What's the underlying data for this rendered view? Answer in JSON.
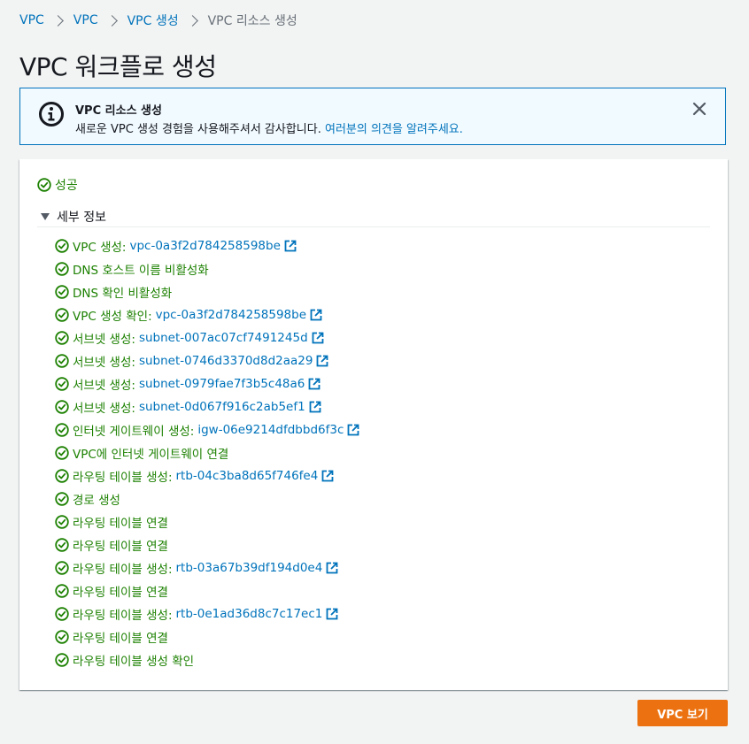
{
  "breadcrumb": {
    "items": [
      "VPC",
      "VPC",
      "VPC 생성"
    ],
    "current": "VPC 리소스 생성"
  },
  "page_title": "VPC 워크플로 생성",
  "flash": {
    "title": "VPC 리소스 생성",
    "message": "새로운 VPC 생성 경험을 사용해주셔서 감사합니다. ",
    "link": "여러분의 의견을 알려주세요."
  },
  "status": {
    "success_label": "성공",
    "details_label": "세부 정보"
  },
  "steps": [
    {
      "label": "VPC 생성:",
      "link": "vpc-0a3f2d784258598be"
    },
    {
      "label": "DNS 호스트 이름 비활성화",
      "link": null
    },
    {
      "label": "DNS 확인 비활성화",
      "link": null
    },
    {
      "label": "VPC 생성 확인:",
      "link": "vpc-0a3f2d784258598be"
    },
    {
      "label": "서브넷 생성:",
      "link": "subnet-007ac07cf7491245d"
    },
    {
      "label": "서브넷 생성:",
      "link": "subnet-0746d3370d8d2aa29"
    },
    {
      "label": "서브넷 생성:",
      "link": "subnet-0979fae7f3b5c48a6"
    },
    {
      "label": "서브넷 생성:",
      "link": "subnet-0d067f916c2ab5ef1"
    },
    {
      "label": "인터넷 게이트웨이 생성:",
      "link": "igw-06e9214dfdbbd6f3c"
    },
    {
      "label": "VPC에 인터넷 게이트웨이 연결",
      "link": null
    },
    {
      "label": "라우팅 테이블 생성:",
      "link": "rtb-04c3ba8d65f746fe4"
    },
    {
      "label": "경로 생성",
      "link": null
    },
    {
      "label": "라우팅 테이블 연결",
      "link": null
    },
    {
      "label": "라우팅 테이블 연결",
      "link": null
    },
    {
      "label": "라우팅 테이블 생성:",
      "link": "rtb-03a67b39df194d0e4"
    },
    {
      "label": "라우팅 테이블 연결",
      "link": null
    },
    {
      "label": "라우팅 테이블 생성:",
      "link": "rtb-0e1ad36d8c7c17ec1"
    },
    {
      "label": "라우팅 테이블 연결",
      "link": null
    },
    {
      "label": "라우팅 테이블 생성 확인",
      "link": null
    }
  ],
  "footer": {
    "view_vpc_label": "VPC 보기"
  },
  "colors": {
    "link": "#0073bb",
    "success": "#1d8102",
    "primary": "#ec7211",
    "info_border": "#0073bb",
    "info_bg": "#f1faff"
  },
  "icons": {
    "info": "info-circle-icon",
    "close": "close-icon",
    "success": "status-check-icon",
    "external": "external-link-icon",
    "caret": "caret-down-icon",
    "separator": "chevron-right-icon"
  }
}
